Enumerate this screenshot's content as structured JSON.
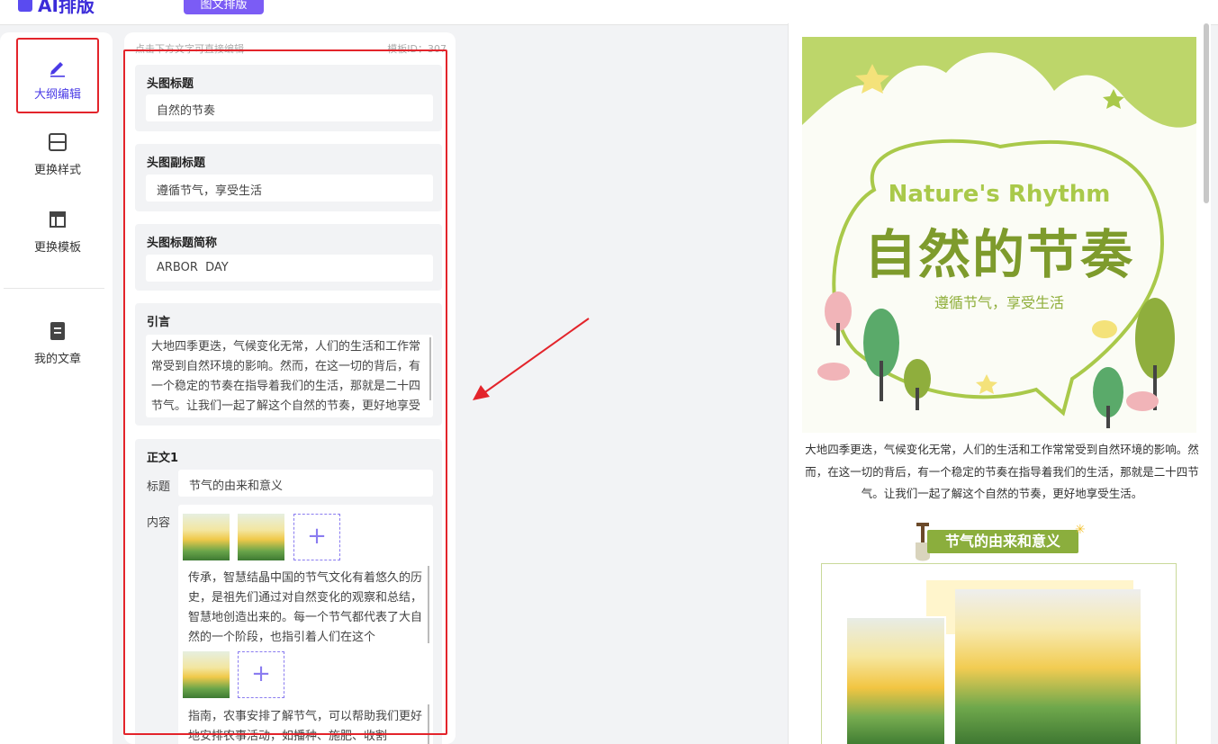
{
  "app": {
    "logo": "AI排版",
    "top_tab": "图文排版"
  },
  "sidebar": {
    "items": [
      {
        "label": "大纲编辑",
        "icon": "pencil-icon",
        "active": true
      },
      {
        "label": "更换样式",
        "icon": "layout-rows-icon"
      },
      {
        "label": "更换模板",
        "icon": "template-icon"
      },
      {
        "label": "我的文章",
        "icon": "document-icon"
      }
    ]
  },
  "editor": {
    "hint": "点击下方文字可直接编辑",
    "template_id": "模板ID：307",
    "header_title": {
      "label": "头图标题",
      "value": "自然的节奏"
    },
    "header_subtitle": {
      "label": "头图副标题",
      "value": "遵循节气，享受生活"
    },
    "header_abbr": {
      "label": "头图标题简称",
      "value": "ARBOR  DAY"
    },
    "intro": {
      "label": "引言",
      "value": "大地四季更迭，气候变化无常，人们的生活和工作常常受到自然环境的影响。然而，在这一切的背后，有一个稳定的节奏在指导着我们的生活，那就是二十四节气。让我们一起了解这个自然的节奏，更好地享受"
    },
    "body1": {
      "label": "正文1",
      "title_label": "标题",
      "title_value": "节气的由来和意义",
      "content_label": "内容",
      "para1": "传承，智慧结晶中国的节气文化有着悠久的历史，是祖先们通过对自然变化的观察和总结，智慧地创造出来的。每一个节气都代表了大自然的一个阶段，也指引着人们在这个",
      "para2": "指南，农事安排了解节气，可以帮助我们更好地安排农事活动，如播种、施肥、收割"
    }
  },
  "preview": {
    "title_en": "Nature's Rhythm",
    "title_cn": "自然的节奏",
    "subtitle": "遵循节气，享受生活",
    "intro": "大地四季更迭，气候变化无常，人们的生活和工作常常受到自然环境的影响。然而，在这一切的背后，有一个稳定的节奏在指导着我们的生活，那就是二十四节气。让我们一起了解这个自然的节奏，更好地享受生活。",
    "section_title": "节气的由来和意义"
  },
  "colors": {
    "accent": "#4a3be6",
    "annotation": "#e3242b",
    "poster_green": "#8bae3d"
  }
}
